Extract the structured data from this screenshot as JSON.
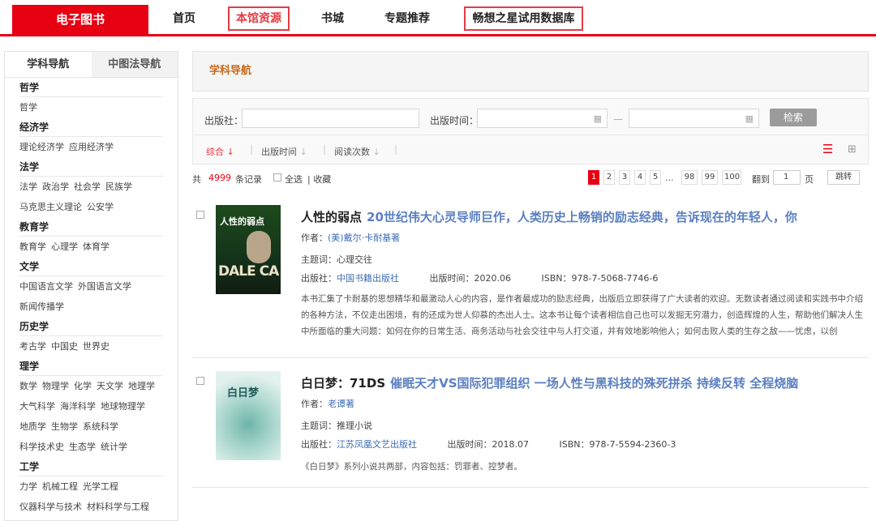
{
  "nav": {
    "brand": "电子图书",
    "items": [
      "首页",
      "本馆资源",
      "书城",
      "专题推荐",
      "畅想之星试用数据库"
    ]
  },
  "sidebar": {
    "tabs": [
      "学科导航",
      "中图法导航"
    ],
    "categories": [
      {
        "head": "哲学",
        "rows": [
          [
            "哲学"
          ]
        ]
      },
      {
        "head": "经济学",
        "rows": [
          [
            "理论经济学",
            "应用经济学"
          ]
        ]
      },
      {
        "head": "法学",
        "rows": [
          [
            "法学",
            "政治学",
            "社会学",
            "民族学"
          ],
          [
            "马克思主义理论",
            "公安学"
          ]
        ]
      },
      {
        "head": "教育学",
        "rows": [
          [
            "教育学",
            "心理学",
            "体育学"
          ]
        ]
      },
      {
        "head": "文学",
        "rows": [
          [
            "中国语言文学",
            "外国语言文学"
          ],
          [
            "新闻传播学"
          ]
        ]
      },
      {
        "head": "历史学",
        "rows": [
          [
            "考古学",
            "中国史",
            "世界史"
          ]
        ]
      },
      {
        "head": "理学",
        "rows": [
          [
            "数学",
            "物理学",
            "化学",
            "天文学",
            "地理学"
          ],
          [
            "大气科学",
            "海洋科学",
            "地球物理学"
          ],
          [
            "地质学",
            "生物学",
            "系统科学"
          ],
          [
            "科学技术史",
            "生态学",
            "统计学"
          ]
        ]
      },
      {
        "head": "工学",
        "rows": [
          [
            "力学",
            "机械工程",
            "光学工程"
          ],
          [
            "仪器科学与技术",
            "材料科学与工程"
          ]
        ]
      }
    ]
  },
  "main": {
    "panel_title": "学科导航",
    "filter": {
      "publisher_label": "出版社：",
      "date_label": "出版时间：",
      "dash": "—",
      "search_btn": "检索"
    },
    "sort": {
      "items": [
        "综合",
        "出版时间",
        "阅读次数"
      ]
    },
    "list": {
      "total_prefix": "共",
      "total": "4999",
      "total_suffix": "条记录",
      "select_all": "全选",
      "fav": "| 收藏",
      "pages": [
        "1",
        "2",
        "3",
        "4",
        "5",
        "...",
        "98",
        "99",
        "100"
      ],
      "goto_label": "翻到",
      "goto_value": "1",
      "page_unit": "页",
      "jump": "跳转"
    },
    "books": [
      {
        "title": "人性的弱点",
        "subtitle": "20世纪伟大心灵导师巨作，人类历史上畅销的励志经典，告诉现在的年轻人，你",
        "author_label": "作者：",
        "author": "(美)戴尔·卡耐基著",
        "subject_label": "主题词：",
        "subject": "心理交往",
        "publisher_label": "出版社：",
        "publisher": "中国书籍出版社",
        "date_label": "出版时间：",
        "date": "2020.06",
        "isbn_label": "ISBN：",
        "isbn": "978-7-5068-7746-6",
        "desc": "本书汇集了卡耐基的思想精华和最激动人心的内容，是作者最成功的励志经典，出版后立即获得了广大读者的欢迎。无数读者通过阅读和实践书中介绍的各种方法，不仅走出困境，有的还成为世人仰慕的杰出人士。这本书让每个读者相信自己也可以发掘无穷潜力，创造辉煌的人生，帮助他们解决人生中所面临的重大问题：如何在你的日常生活、商务活动与社会交往中与人打交道，并有效地影响他人；如何击败人类的生存之敌——忧虑，以创",
        "cover_title": "人性的弱点",
        "cover_letters": "DALE CA"
      },
      {
        "title": "白日梦：71DS",
        "subtitle": "催眠天才VS国际犯罪组织 一场人性与黑科技的殊死拼杀 持续反转 全程烧脑",
        "author_label": "作者：",
        "author": "老谭著",
        "subject_label": "主题词：",
        "subject": "推理小说",
        "publisher_label": "出版社：",
        "publisher": "江苏凤凰文艺出版社",
        "date_label": "出版时间：",
        "date": "2018.07",
        "isbn_label": "ISBN：",
        "isbn": "978-7-5594-2360-3",
        "desc": "《白日梦》系列小说共两部，内容包括：罚罪者、控梦者。",
        "cover_title": "白日梦",
        "cover_letters": ""
      }
    ]
  }
}
